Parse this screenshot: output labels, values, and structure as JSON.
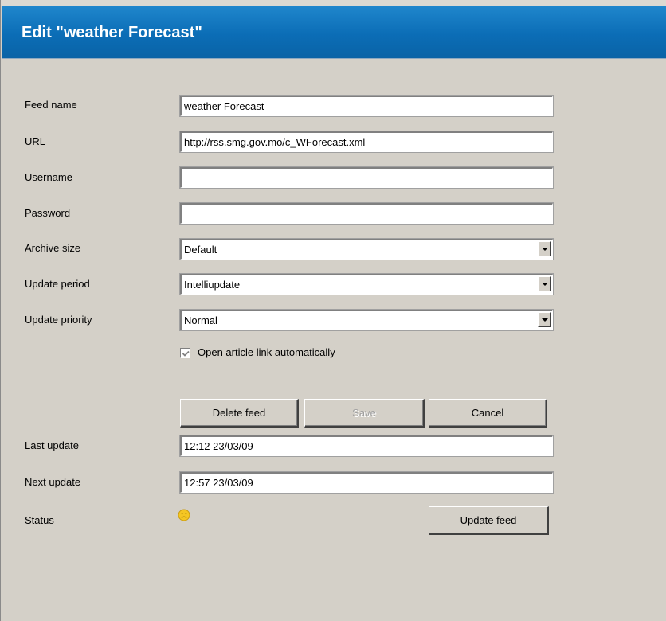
{
  "dialog": {
    "title": "Edit \"weather Forecast\""
  },
  "form": {
    "feed_name": {
      "label": "Feed name",
      "value": "weather Forecast"
    },
    "url": {
      "label": "URL",
      "value": "http://rss.smg.gov.mo/c_WForecast.xml"
    },
    "username": {
      "label": "Username",
      "value": ""
    },
    "password": {
      "label": "Password",
      "value": ""
    },
    "archive_size": {
      "label": "Archive size",
      "value": "Default"
    },
    "update_period": {
      "label": "Update period",
      "value": "Intelliupdate"
    },
    "update_priority": {
      "label": "Update priority",
      "value": "Normal"
    },
    "open_article": {
      "label": "Open article link automatically",
      "checked": true,
      "enabled": false
    }
  },
  "buttons": {
    "delete": "Delete feed",
    "save": "Save",
    "cancel": "Cancel",
    "update": "Update feed"
  },
  "info": {
    "last_update": {
      "label": "Last update",
      "value": "12:12 23/03/09"
    },
    "next_update": {
      "label": "Next update",
      "value": "12:57 23/03/09"
    },
    "status": {
      "label": "Status",
      "icon": "sad-face-icon"
    }
  },
  "colors": {
    "titlebar": "#0b6db6",
    "background": "#d4d0c8"
  }
}
